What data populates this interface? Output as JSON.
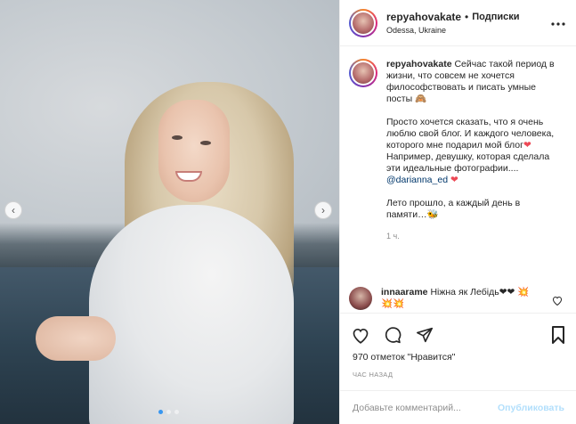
{
  "post": {
    "username": "repyahovakate",
    "bullet": "•",
    "follow_label": "Подписки",
    "location": "Odessa, Ukraine",
    "more_icon": "more-horizontal-icon"
  },
  "caption": {
    "username": "repyahovakate",
    "para1": " Сейчас такой период в жизни, что совсем не хочется философствовать и писать умные посты 🙈",
    "para2": "Просто хочется сказать, что я очень люблю свой блог. И каждого человека, которого мне подарил мой блог",
    "para2_heart": "❤",
    "para3": "Например, девушку, которая сделала эти идеальные фотографии.... ",
    "mention": "@darianna_ed",
    "para3_heart": " ❤",
    "para4": "Лето прошло, а каждый день в памяти…🐝",
    "time": "1 ч."
  },
  "comment": {
    "username": "innaarame",
    "text": " Ніжна як Лебідь❤❤ 💥💥💥"
  },
  "stats": {
    "likes": "970 отметок \"Нравится\"",
    "ago": "ЧАС НАЗАД"
  },
  "add_comment": {
    "placeholder": "Добавьте комментарий...",
    "publish": "Опубликовать"
  },
  "carousel": {
    "current": 1,
    "total": 3
  },
  "colors": {
    "accent": "#3897f0",
    "link": "#00376b",
    "muted": "#8e8e8e",
    "publish_disabled": "#b2dffc"
  }
}
